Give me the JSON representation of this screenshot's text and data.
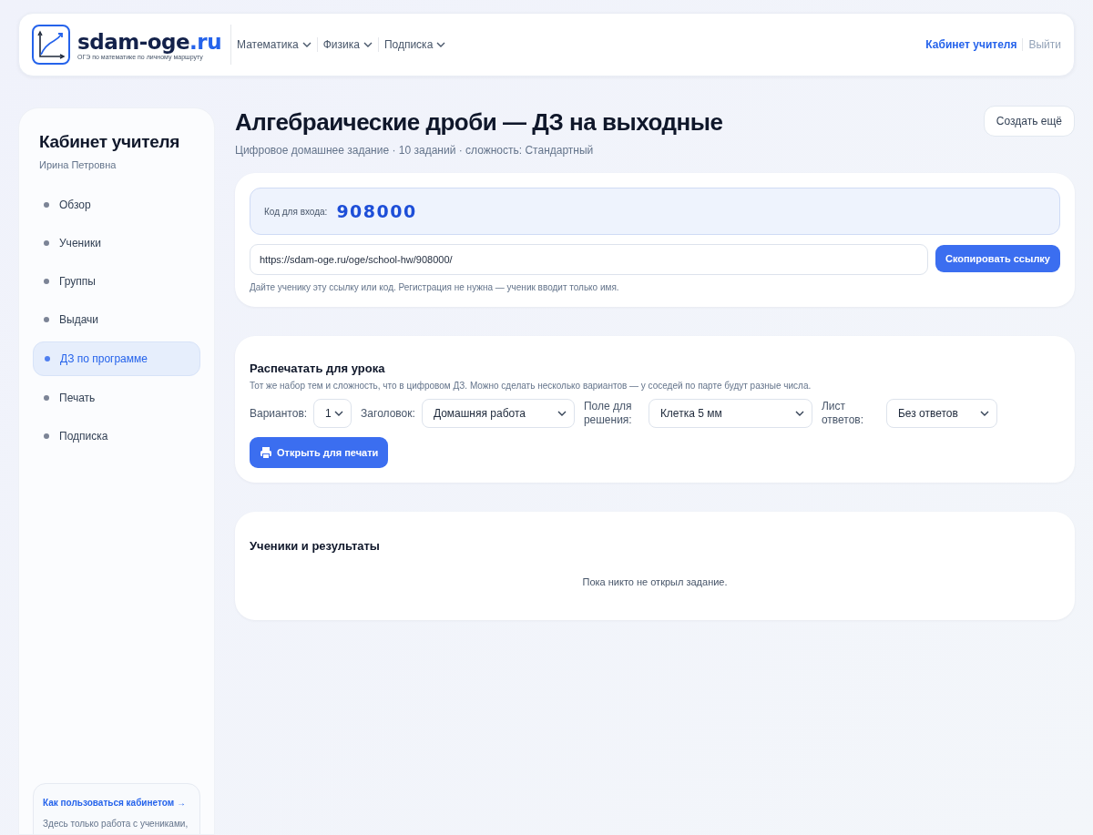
{
  "header": {
    "brand_main": "sdam-oge",
    "brand_accent": ".ru",
    "tagline": "ОГЭ по математике по личному маршруту",
    "nav": [
      {
        "label": "Математика"
      },
      {
        "label": "Физика"
      },
      {
        "label": "Подписка"
      }
    ],
    "account_link": "Кабинет учителя",
    "logout_link": "Выйти"
  },
  "sidebar": {
    "title": "Кабинет учителя",
    "user": "Ирина Петровна",
    "items": [
      {
        "label": "Обзор",
        "selected": false
      },
      {
        "label": "Ученики",
        "selected": false
      },
      {
        "label": "Группы",
        "selected": false
      },
      {
        "label": "Выдачи",
        "selected": false
      },
      {
        "label": "ДЗ по программе",
        "selected": true
      },
      {
        "label": "Печать",
        "selected": false
      },
      {
        "label": "Подписка",
        "selected": false
      }
    ],
    "help": {
      "link": "Как пользоваться кабинетом →",
      "text": "Здесь только работа с учениками,"
    }
  },
  "page": {
    "title": "Алгебраические дроби — ДЗ на выходные",
    "subtitle": "Цифровое домашнее задание · 10 заданий · сложность: Стандартный",
    "create_button": "Создать ещё"
  },
  "access": {
    "code_label": "Код для входа:",
    "code": "908000",
    "link_value": "https://sdam-oge.ru/oge/school-hw/908000/",
    "copy_button": "Скопировать ссылку",
    "hint": "Дайте ученику эту ссылку или код. Регистрация не нужна — ученик вводит только имя."
  },
  "print": {
    "title": "Распечатать для урока",
    "description": "Тот же набор тем и сложность, что в цифровом ДЗ. Можно сделать несколько вариантов — у соседей по парте будут разные числа.",
    "fields": [
      {
        "label": "Вариантов:",
        "value": "1"
      },
      {
        "label": "Заголовок:",
        "value": "Домашняя работа"
      },
      {
        "label": "Поле для решения:",
        "value": "Клетка 5 мм"
      },
      {
        "label": "Лист ответов:",
        "value": "Без ответов"
      }
    ],
    "print_button": "Открыть для печати"
  },
  "results": {
    "title": "Ученики и результаты",
    "empty": "Пока никто не открыл задание."
  }
}
